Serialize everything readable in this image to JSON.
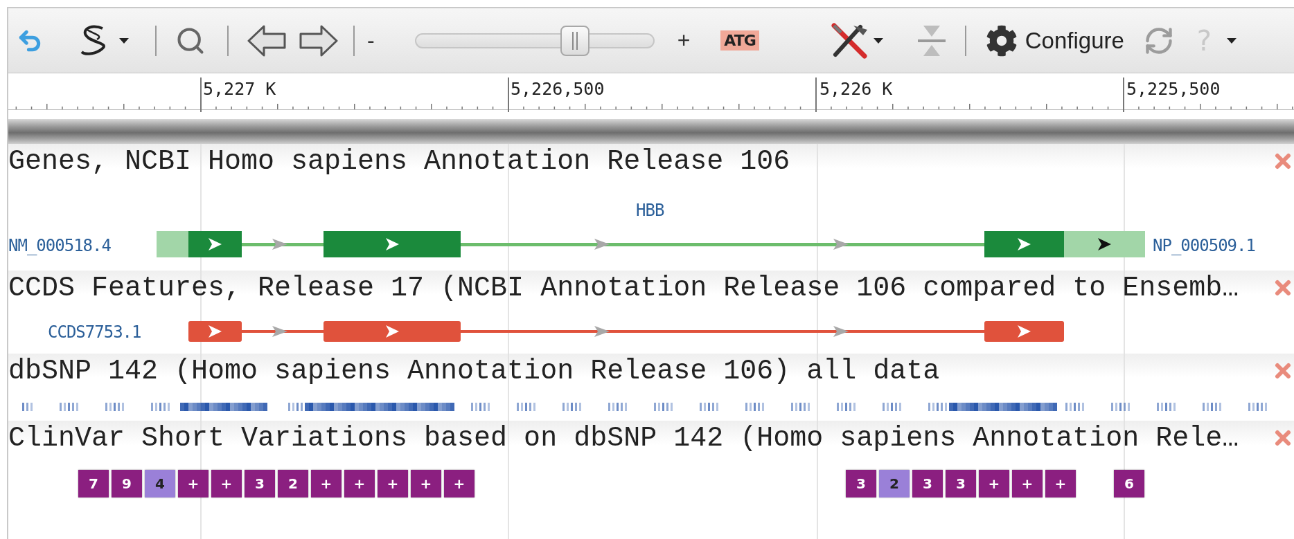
{
  "toolbar": {
    "zoom_out": "-",
    "zoom_in": "+",
    "sequence_button": "ATG",
    "configure_button": "Configure",
    "help_button": "?"
  },
  "ruler": {
    "labels": [
      "5,227 K",
      "5,226,500",
      "5,226 K",
      "5,225,500"
    ]
  },
  "tracks": [
    {
      "kind": "gene",
      "title": "Genes, NCBI Homo sapiens Annotation Release 106",
      "gene_label": "HBB",
      "left_label": "NM_000518.4",
      "right_label": "NP_000509.1"
    },
    {
      "kind": "ccds",
      "title": "CCDS Features, Release 17 (NCBI Annotation Release 106 compared to Ensemb…",
      "left_label": "CCDS7753.1"
    },
    {
      "kind": "snp",
      "title": "dbSNP 142 (Homo sapiens Annotation Release 106) all data"
    },
    {
      "kind": "clinvar",
      "title": "ClinVar Short Variations based on dbSNP 142 (Homo sapiens Annotation Rele…",
      "groups": [
        {
          "items": [
            {
              "label": "7",
              "color": "#8b1f80"
            },
            {
              "label": "9",
              "color": "#8b1f80"
            },
            {
              "label": "4",
              "color": "#9a80d8"
            },
            {
              "label": "+",
              "color": "#8b1f80"
            },
            {
              "label": "+",
              "color": "#8b1f80"
            },
            {
              "label": "3",
              "color": "#8b1f80"
            },
            {
              "label": "2",
              "color": "#8b1f80"
            },
            {
              "label": "+",
              "color": "#8b1f80"
            },
            {
              "label": "+",
              "color": "#8b1f80"
            },
            {
              "label": "+",
              "color": "#8b1f80"
            },
            {
              "label": "+",
              "color": "#8b1f80"
            },
            {
              "label": "+",
              "color": "#8b1f80"
            }
          ]
        },
        {
          "items": [
            {
              "label": "3",
              "color": "#8b1f80"
            },
            {
              "label": "2",
              "color": "#9a80d8"
            },
            {
              "label": "3",
              "color": "#8b1f80"
            },
            {
              "label": "3",
              "color": "#8b1f80"
            },
            {
              "label": "+",
              "color": "#8b1f80"
            },
            {
              "label": "+",
              "color": "#8b1f80"
            },
            {
              "label": "+",
              "color": "#8b1f80"
            }
          ]
        },
        {
          "items": [
            {
              "label": "6",
              "color": "#8b1f80"
            }
          ]
        }
      ]
    }
  ]
}
